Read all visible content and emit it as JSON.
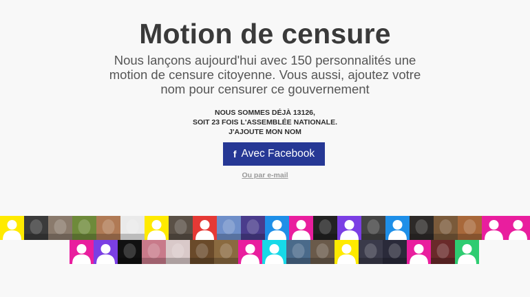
{
  "header": {
    "title": "Motion de censure",
    "subtitle_lines": [
      "Nous lançons aujourd'hui avec 150 personnalités une",
      "motion de censure citoyenne. Vous aussi, ajoutez votre",
      "nom pour censurer ce gouvernement"
    ]
  },
  "counter": {
    "line1": "NOUS SOMMES DÉJÀ 13126,",
    "line2": "SOIT 23 FOIS L'ASSEMBLÉE NATIONALE.",
    "line3": "J'AJOUTE MON NOM"
  },
  "actions": {
    "facebook_icon": "f",
    "facebook_label": "Avec Facebook",
    "email_label": "Ou par e-mail"
  },
  "colors": {
    "facebook_blue": "#263895",
    "yellow": "#ffea00",
    "magenta": "#e91e9e",
    "blue": "#1e8fe8",
    "violet": "#7b3fe4",
    "cyan": "#17d9e8",
    "red": "#e53935",
    "green": "#2ecc71"
  },
  "avatars": {
    "row1": [
      {
        "kind": "placeholder",
        "color": "yellow"
      },
      {
        "kind": "photo",
        "icon": "wolf-photo",
        "bg": "#3b3b3b"
      },
      {
        "kind": "photo",
        "icon": "couple-photo",
        "bg": "#8a7a6c"
      },
      {
        "kind": "photo",
        "icon": "foliage-photo",
        "bg": "#6e8a3a"
      },
      {
        "kind": "photo",
        "icon": "portrait-photo",
        "bg": "#b07a55"
      },
      {
        "kind": "photo",
        "icon": "dandelion-photo",
        "bg": "#eaeaea"
      },
      {
        "kind": "placeholder",
        "color": "yellow"
      },
      {
        "kind": "photo",
        "icon": "man-photo",
        "bg": "#5a5046"
      },
      {
        "kind": "placeholder",
        "color": "red"
      },
      {
        "kind": "photo",
        "icon": "flag-photo",
        "bg": "#6f8fc9"
      },
      {
        "kind": "photo",
        "icon": "halo-photo",
        "bg": "#4a3c8c"
      },
      {
        "kind": "placeholder",
        "color": "blue"
      },
      {
        "kind": "placeholder",
        "color": "magenta"
      },
      {
        "kind": "photo",
        "icon": "cat-photo",
        "bg": "#222222"
      },
      {
        "kind": "placeholder",
        "color": "violet"
      },
      {
        "kind": "photo",
        "icon": "man-dark-photo",
        "bg": "#444444"
      },
      {
        "kind": "placeholder",
        "color": "blue"
      },
      {
        "kind": "photo",
        "icon": "couple-dark-photo",
        "bg": "#2d2a28"
      },
      {
        "kind": "photo",
        "icon": "people-photo",
        "bg": "#7a5a3a"
      },
      {
        "kind": "photo",
        "icon": "painting-photo",
        "bg": "#a8683a"
      },
      {
        "kind": "placeholder",
        "color": "magenta"
      },
      {
        "kind": "placeholder",
        "color": "magenta"
      },
      {
        "kind": "photo",
        "icon": "dog-photo",
        "bg": "#9c8a70"
      }
    ],
    "row2": [
      {
        "kind": "placeholder",
        "color": "magenta"
      },
      {
        "kind": "placeholder",
        "color": "violet"
      },
      {
        "kind": "photo",
        "icon": "art-photo",
        "bg": "#111111"
      },
      {
        "kind": "photo",
        "icon": "woman-photo",
        "bg": "#c87a8a"
      },
      {
        "kind": "photo",
        "icon": "flag-faded-photo",
        "bg": "#d9c9c9"
      },
      {
        "kind": "photo",
        "icon": "masks-photo",
        "bg": "#6a4a2a"
      },
      {
        "kind": "photo",
        "icon": "group-photo",
        "bg": "#8a6a40"
      },
      {
        "kind": "placeholder",
        "color": "magenta"
      },
      {
        "kind": "placeholder",
        "color": "cyan"
      },
      {
        "kind": "photo",
        "icon": "landscape-photo",
        "bg": "#4a6a8a"
      },
      {
        "kind": "photo",
        "icon": "selfie-photo",
        "bg": "#6a5a4a"
      },
      {
        "kind": "placeholder",
        "color": "yellow"
      },
      {
        "kind": "photo",
        "icon": "man-sunglasses-photo",
        "bg": "#3a3a4a"
      },
      {
        "kind": "photo",
        "icon": "couple-night-photo",
        "bg": "#2a2a3a"
      },
      {
        "kind": "placeholder",
        "color": "magenta"
      },
      {
        "kind": "photo",
        "icon": "stripes-photo",
        "bg": "#6a2a2a"
      },
      {
        "kind": "placeholder",
        "color": "green"
      }
    ]
  }
}
